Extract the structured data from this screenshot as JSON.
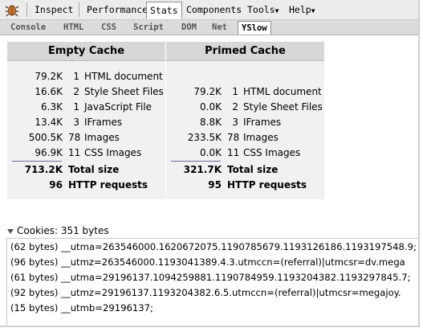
{
  "toolbar": {
    "items": [
      {
        "label": "Inspect",
        "active": false
      },
      {
        "label": "Performance",
        "active": false
      },
      {
        "label": "Stats",
        "active": true
      },
      {
        "label": "Components",
        "active": false
      },
      {
        "label": "Tools",
        "active": false,
        "dropdown": true
      },
      {
        "label": "Help",
        "active": false,
        "dropdown": true
      }
    ]
  },
  "subtabs": [
    {
      "label": "Console",
      "active": false
    },
    {
      "label": "HTML",
      "active": false
    },
    {
      "label": "CSS",
      "active": false
    },
    {
      "label": "Script",
      "active": false
    },
    {
      "label": "DOM",
      "active": false
    },
    {
      "label": "Net",
      "active": false
    },
    {
      "label": "YSlow",
      "active": true
    }
  ],
  "empty_cache": {
    "title": "Empty Cache",
    "rows": [
      {
        "size": "79.2K",
        "count": "1",
        "label": "HTML document"
      },
      {
        "size": "16.6K",
        "count": "2",
        "label": "Style Sheet Files"
      },
      {
        "size": "6.3K",
        "count": "1",
        "label": "JavaScript File"
      },
      {
        "size": "13.4K",
        "count": "3",
        "label": "IFrames"
      },
      {
        "size": "500.5K",
        "count": "78",
        "label": "Images"
      },
      {
        "size": "96.9K",
        "count": "11",
        "label": "CSS Images"
      }
    ],
    "total_size": "713.2K",
    "total_label": "Total size",
    "requests": "96",
    "requests_label": "HTTP requests"
  },
  "primed_cache": {
    "title": "Primed Cache",
    "rows": [
      {
        "size": "79.2K",
        "count": "1",
        "label": "HTML document"
      },
      {
        "size": "0.0K",
        "count": "2",
        "label": "Style Sheet Files"
      },
      {
        "size": "8.8K",
        "count": "3",
        "label": "IFrames"
      },
      {
        "size": "233.5K",
        "count": "78",
        "label": "Images"
      },
      {
        "size": "0.0K",
        "count": "11",
        "label": "CSS Images"
      }
    ],
    "total_size": "321.7K",
    "total_label": "Total size",
    "requests": "95",
    "requests_label": "HTTP requests"
  },
  "cookies": {
    "title": "Cookies: 351 bytes",
    "lines": [
      "(62 bytes) __utma=263546000.1620672075.1190785679.1193126186.1193197548.9;",
      "(96 bytes) __utmz=263546000.1193041389.4.3.utmccn=(referral)|utmcsr=dv.mega",
      "(61 bytes) __utma=29196137.1094259881.1190784959.1193204382.1193297845.7;",
      "(92 bytes) __utmz=29196137.1193204382.6.5.utmccn=(referral)|utmcsr=megajoy.",
      "(15 bytes) __utmb=29196137;"
    ]
  }
}
